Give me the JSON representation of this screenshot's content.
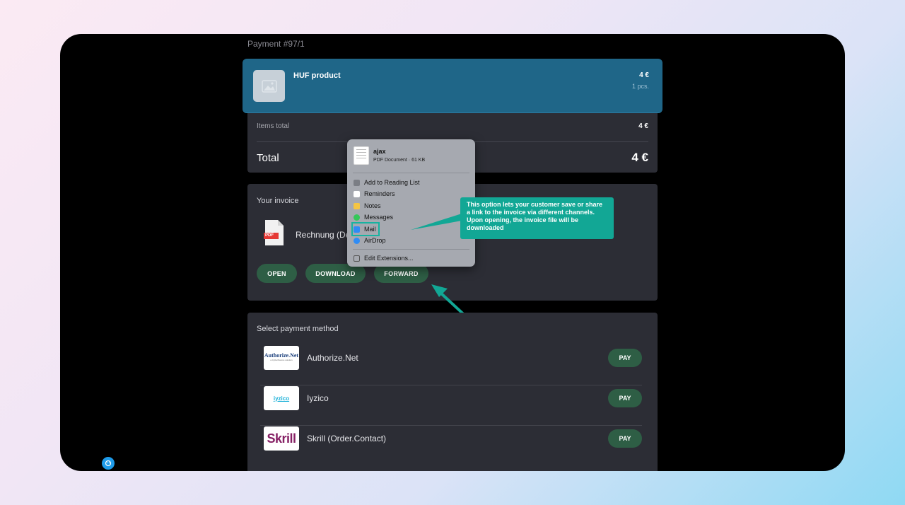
{
  "header": {
    "payment_title": "Payment #97/1"
  },
  "product": {
    "name": "HUF product",
    "price": "4 €",
    "quantity": "1 pcs."
  },
  "totals": {
    "items_total_label": "Items total",
    "items_total_value": "4 €",
    "total_label": "Total",
    "total_value": "4 €"
  },
  "invoice": {
    "heading": "Your invoice",
    "file_icon_text": "PDF",
    "filename": "Rechnung (De",
    "buttons": {
      "open": "OPEN",
      "download": "DOWNLOAD",
      "forward": "FORWARD"
    }
  },
  "share_sheet": {
    "title": "ajax",
    "subtitle": "PDF Document · 61 KB",
    "items": [
      {
        "label": "Add to Reading List",
        "icon": "reading-list-icon",
        "color": "#7b7e85"
      },
      {
        "label": "Reminders",
        "icon": "reminders-icon",
        "color": "#ffffff"
      },
      {
        "label": "Notes",
        "icon": "notes-icon",
        "color": "#f5c542"
      },
      {
        "label": "Messages",
        "icon": "messages-icon",
        "color": "#35c759"
      },
      {
        "label": "Mail",
        "icon": "mail-icon",
        "color": "#2f8cf5"
      },
      {
        "label": "AirDrop",
        "icon": "airdrop-icon",
        "color": "#2f8cf5"
      }
    ],
    "edit_extensions": "Edit Extensions..."
  },
  "tooltip": {
    "text": "This option lets your customer save or share a link to the invoice via different channels. Upon opening, the invoice file will be downloaded"
  },
  "payment": {
    "heading": "Select payment method",
    "methods": [
      {
        "name": "Authorize.Net",
        "logo_text": "Authorize.Net",
        "logo_sub": "a CyberSource solution",
        "button": "PAY"
      },
      {
        "name": "Iyzico",
        "logo_text": "iyzico",
        "button": "PAY"
      },
      {
        "name": "Skrill (Order.Contact)",
        "logo_text": "Skrill",
        "button": "PAY"
      }
    ]
  },
  "colors": {
    "accent_teal": "#12a795",
    "product_card": "#1f6688",
    "button_green": "#2e5e45",
    "card_bg": "#2c2d35"
  }
}
